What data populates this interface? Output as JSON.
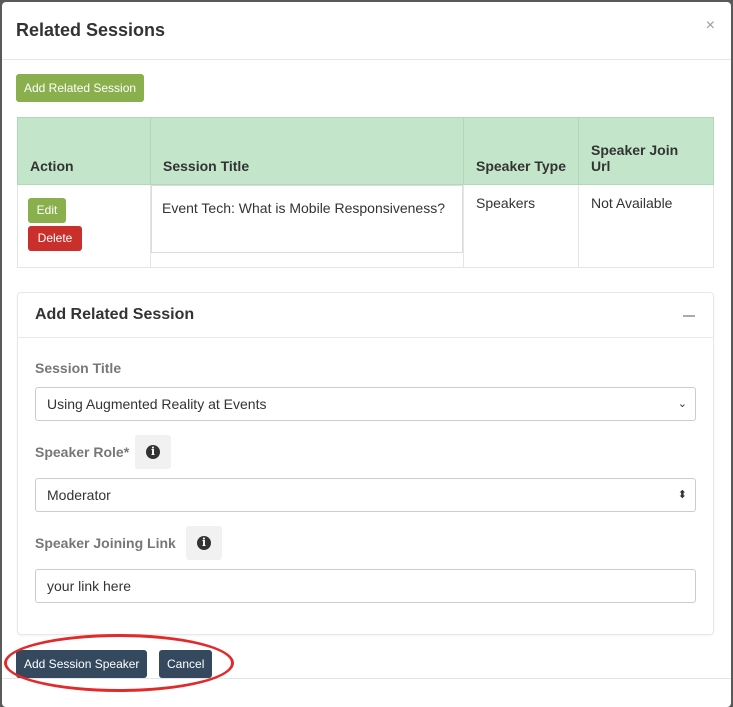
{
  "modal": {
    "title": "Related Sessions",
    "close_label": "×",
    "add_related_label": "Add Related Session"
  },
  "table": {
    "headers": [
      "Action",
      "Session Title",
      "Speaker Type",
      "Speaker Join Url"
    ],
    "rows": [
      {
        "edit_label": "Edit",
        "delete_label": "Delete",
        "session_title": "Event Tech: What is Mobile Responsiveness?",
        "speaker_type": "Speakers",
        "join_url": "Not Available"
      }
    ]
  },
  "panel": {
    "title": "Add Related Session",
    "session_title_label": "Session Title",
    "session_title_value": "Using Augmented Reality at Events",
    "speaker_role_label": "Speaker Role*",
    "speaker_role_value": "Moderator",
    "joining_link_label": "Speaker Joining Link",
    "joining_link_value": "your link here"
  },
  "footer": {
    "add_speaker_label": "Add Session Speaker",
    "cancel_label": "Cancel"
  },
  "colors": {
    "header_green": "#c3e6cb",
    "button_green": "#8ab04d",
    "button_red": "#c9302c",
    "button_dark": "#34495e",
    "highlight_red": "#e32a2a"
  }
}
